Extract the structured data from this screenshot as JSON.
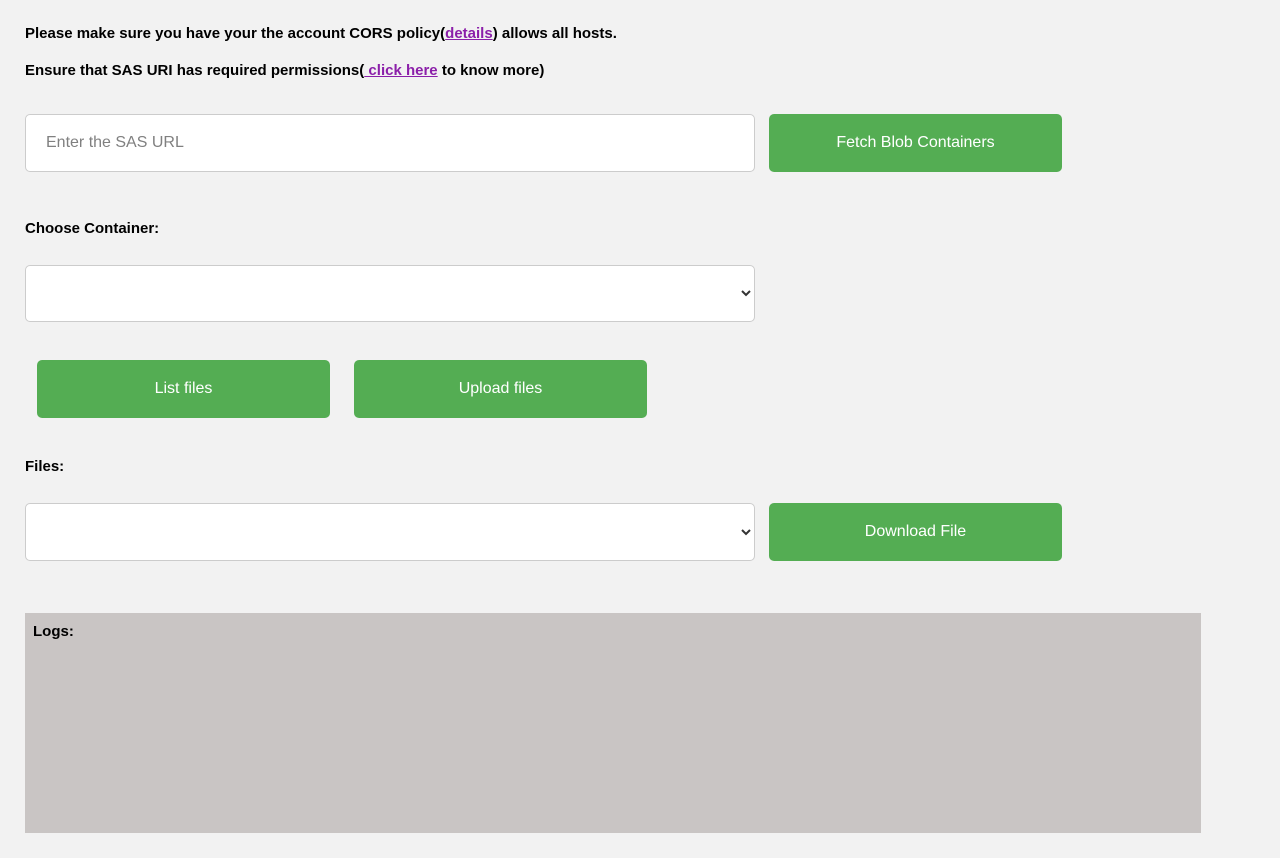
{
  "notices": {
    "cors_pre": "Please make sure you have your the account CORS policy(",
    "cors_link": "details",
    "cors_post": ") allows all hosts.",
    "sas_pre": "Ensure that SAS URI has required permissions(",
    "sas_link": " click here",
    "sas_post": " to know more)"
  },
  "sas_input": {
    "value": "",
    "placeholder": "Enter the SAS URL"
  },
  "buttons": {
    "fetch": "Fetch Blob Containers",
    "list_files": "List files",
    "upload_files": "Upload files",
    "download_file": "Download File"
  },
  "labels": {
    "choose_container": "Choose Container:",
    "files": "Files:",
    "logs": "Logs:"
  },
  "container_select": {
    "value": ""
  },
  "files_select": {
    "value": ""
  },
  "logs": {
    "content": ""
  }
}
